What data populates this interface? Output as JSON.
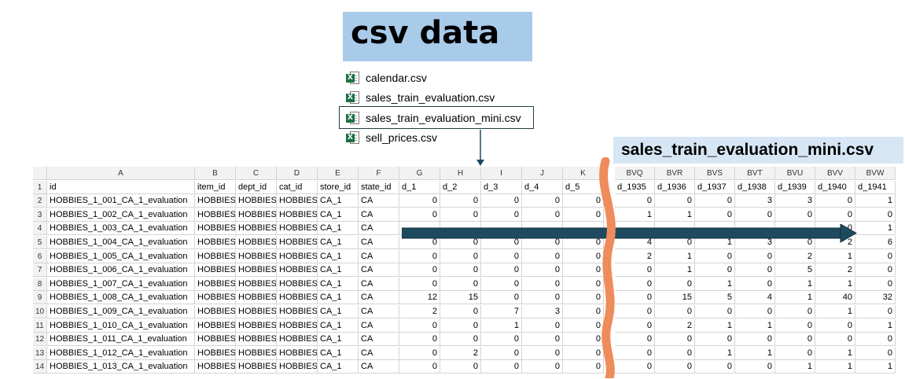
{
  "title": "csv data",
  "files": [
    {
      "name": "calendar.csv",
      "selected": false
    },
    {
      "name": "sales_train_evaluation.csv",
      "selected": false
    },
    {
      "name": "sales_train_evaluation_mini.csv",
      "selected": true
    },
    {
      "name": "sell_prices.csv",
      "selected": false
    }
  ],
  "mini_label": "sales_train_evaluation_mini.csv",
  "colors": {
    "title_bg": "#a9cbea",
    "mini_bg": "#d6e6f5",
    "arrow": "#1e4a5f",
    "wave": "#ef8c5b",
    "excel_green": "#1e7145"
  },
  "left_columns": [
    "A",
    "B",
    "C",
    "D",
    "E",
    "F",
    "G",
    "H",
    "I",
    "J",
    "K"
  ],
  "left_headers": [
    "id",
    "item_id",
    "dept_id",
    "cat_id",
    "store_id",
    "state_id",
    "d_1",
    "d_2",
    "d_3",
    "d_4",
    "d_5"
  ],
  "right_columns": [
    "BVQ",
    "BVR",
    "BVS",
    "BVT",
    "BVU",
    "BVV",
    "BVW"
  ],
  "right_headers": [
    "d_1935",
    "d_1936",
    "d_1937",
    "d_1938",
    "d_1939",
    "d_1940",
    "d_1941"
  ],
  "row_numbers": [
    "1",
    "2",
    "3",
    "4",
    "5",
    "6",
    "7",
    "8",
    "9",
    "10",
    "11",
    "12",
    "13",
    "14"
  ],
  "rows": [
    {
      "id": "HOBBIES_1_001_CA_1_evaluation",
      "item": "HOBBIES_",
      "dept": "HOBBIES_",
      "cat": "HOBBIES",
      "store": "CA_1",
      "state": "CA",
      "left": [
        "0",
        "0",
        "0",
        "0",
        "0"
      ],
      "right": [
        "0",
        "0",
        "0",
        "3",
        "3",
        "0",
        "1"
      ]
    },
    {
      "id": "HOBBIES_1_002_CA_1_evaluation",
      "item": "HOBBIES_",
      "dept": "HOBBIES_",
      "cat": "HOBBIES",
      "store": "CA_1",
      "state": "CA",
      "left": [
        "0",
        "0",
        "0",
        "0",
        "0"
      ],
      "right": [
        "1",
        "1",
        "0",
        "0",
        "0",
        "0",
        "0"
      ]
    },
    {
      "id": "HOBBIES_1_003_CA_1_evaluation",
      "item": "HOBBIES_",
      "dept": "HOBBIES_",
      "cat": "HOBBIES",
      "store": "CA_1",
      "state": "CA",
      "left": [
        "",
        "",
        "",
        "",
        ""
      ],
      "right": [
        "",
        "",
        "",
        "",
        "",
        "0",
        "1"
      ]
    },
    {
      "id": "HOBBIES_1_004_CA_1_evaluation",
      "item": "HOBBIES_",
      "dept": "HOBBIES_",
      "cat": "HOBBIES",
      "store": "CA_1",
      "state": "CA",
      "left": [
        "0",
        "0",
        "0",
        "0",
        "0"
      ],
      "right": [
        "4",
        "0",
        "1",
        "3",
        "0",
        "2",
        "6"
      ]
    },
    {
      "id": "HOBBIES_1_005_CA_1_evaluation",
      "item": "HOBBIES_",
      "dept": "HOBBIES_",
      "cat": "HOBBIES",
      "store": "CA_1",
      "state": "CA",
      "left": [
        "0",
        "0",
        "0",
        "0",
        "0"
      ],
      "right": [
        "2",
        "1",
        "0",
        "0",
        "2",
        "1",
        "0"
      ]
    },
    {
      "id": "HOBBIES_1_006_CA_1_evaluation",
      "item": "HOBBIES_",
      "dept": "HOBBIES_",
      "cat": "HOBBIES",
      "store": "CA_1",
      "state": "CA",
      "left": [
        "0",
        "0",
        "0",
        "0",
        "0"
      ],
      "right": [
        "0",
        "1",
        "0",
        "0",
        "5",
        "2",
        "0"
      ]
    },
    {
      "id": "HOBBIES_1_007_CA_1_evaluation",
      "item": "HOBBIES_",
      "dept": "HOBBIES_",
      "cat": "HOBBIES",
      "store": "CA_1",
      "state": "CA",
      "left": [
        "0",
        "0",
        "0",
        "0",
        "0"
      ],
      "right": [
        "0",
        "0",
        "1",
        "0",
        "1",
        "1",
        "0"
      ]
    },
    {
      "id": "HOBBIES_1_008_CA_1_evaluation",
      "item": "HOBBIES_",
      "dept": "HOBBIES_",
      "cat": "HOBBIES",
      "store": "CA_1",
      "state": "CA",
      "left": [
        "12",
        "15",
        "0",
        "0",
        "0"
      ],
      "right": [
        "0",
        "15",
        "5",
        "4",
        "1",
        "40",
        "32"
      ]
    },
    {
      "id": "HOBBIES_1_009_CA_1_evaluation",
      "item": "HOBBIES_",
      "dept": "HOBBIES_",
      "cat": "HOBBIES",
      "store": "CA_1",
      "state": "CA",
      "left": [
        "2",
        "0",
        "7",
        "3",
        "0"
      ],
      "right": [
        "0",
        "0",
        "0",
        "0",
        "0",
        "1",
        "0"
      ]
    },
    {
      "id": "HOBBIES_1_010_CA_1_evaluation",
      "item": "HOBBIES_",
      "dept": "HOBBIES_",
      "cat": "HOBBIES",
      "store": "CA_1",
      "state": "CA",
      "left": [
        "0",
        "0",
        "1",
        "0",
        "0"
      ],
      "right": [
        "0",
        "2",
        "1",
        "1",
        "0",
        "0",
        "1"
      ]
    },
    {
      "id": "HOBBIES_1_011_CA_1_evaluation",
      "item": "HOBBIES_",
      "dept": "HOBBIES_",
      "cat": "HOBBIES",
      "store": "CA_1",
      "state": "CA",
      "left": [
        "0",
        "0",
        "0",
        "0",
        "0"
      ],
      "right": [
        "0",
        "0",
        "0",
        "0",
        "0",
        "0",
        "0"
      ]
    },
    {
      "id": "HOBBIES_1_012_CA_1_evaluation",
      "item": "HOBBIES_",
      "dept": "HOBBIES_",
      "cat": "HOBBIES",
      "store": "CA_1",
      "state": "CA",
      "left": [
        "0",
        "2",
        "0",
        "0",
        "0"
      ],
      "right": [
        "0",
        "0",
        "1",
        "1",
        "0",
        "1",
        "0"
      ]
    },
    {
      "id": "HOBBIES_1_013_CA_1_evaluation",
      "item": "HOBBIES_",
      "dept": "HOBBIES_",
      "cat": "HOBBIES",
      "store": "CA_1",
      "state": "CA",
      "left": [
        "0",
        "0",
        "0",
        "0",
        "0"
      ],
      "right": [
        "0",
        "0",
        "0",
        "0",
        "1",
        "1",
        "1"
      ]
    }
  ]
}
